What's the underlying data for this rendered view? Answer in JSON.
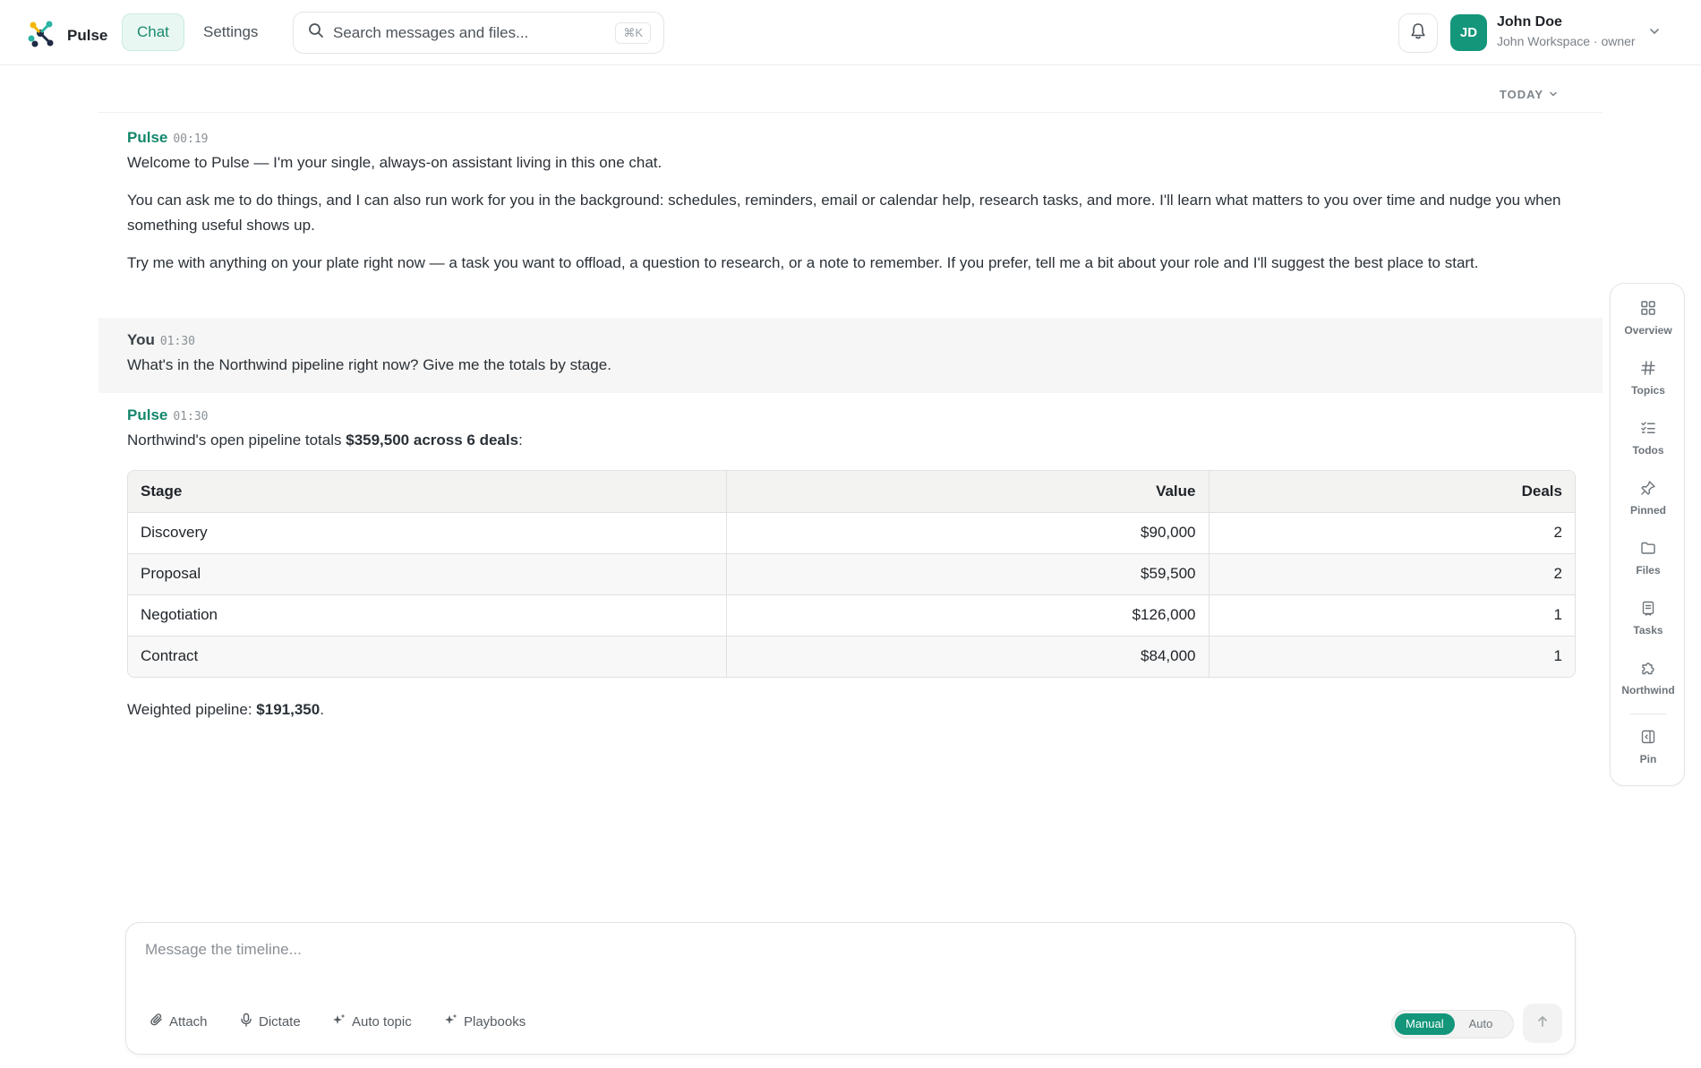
{
  "app": {
    "name": "Pulse"
  },
  "nav": {
    "tabs": [
      {
        "label": "Chat",
        "active": true
      },
      {
        "label": "Settings",
        "active": false
      }
    ]
  },
  "search": {
    "placeholder": "Search messages and files...",
    "shortcut": "⌘K"
  },
  "user": {
    "initials": "JD",
    "name": "John Doe",
    "subtitle": "John Workspace · owner"
  },
  "timeline": {
    "day_label": "TODAY",
    "messages": [
      {
        "author": "Pulse",
        "time": "00:19",
        "paragraphs": [
          "Welcome to Pulse — I'm your single, always-on assistant living in this one chat.",
          "You can ask me to do things, and I can also run work for you in the background: schedules, reminders, email or calendar help, research tasks, and more. I'll learn what matters to you over time and nudge you when something useful shows up.",
          "Try me with anything on your plate right now — a task you want to offload, a question to research, or a note to remember. If you prefer, tell me a bit about your role and I'll suggest the best place to start."
        ]
      },
      {
        "author": "You",
        "time": "01:30",
        "text": "What's in the Northwind pipeline right now? Give me the totals by stage."
      },
      {
        "author": "Pulse",
        "time": "01:30",
        "intro_prefix": "Northwind's open pipeline totals ",
        "intro_bold": "$359,500 across 6 deals",
        "intro_suffix": ":",
        "table": {
          "headers": [
            "Stage",
            "Value",
            "Deals"
          ],
          "rows": [
            [
              "Discovery",
              "$90,000",
              "2"
            ],
            [
              "Proposal",
              "$59,500",
              "2"
            ],
            [
              "Negotiation",
              "$126,000",
              "1"
            ],
            [
              "Contract",
              "$84,000",
              "1"
            ]
          ]
        },
        "weighted_prefix": "Weighted pipeline: ",
        "weighted_bold": "$191,350",
        "weighted_suffix": "."
      }
    ]
  },
  "rail": {
    "items": [
      {
        "label": "Overview",
        "icon": "grid-icon"
      },
      {
        "label": "Topics",
        "icon": "hash-icon"
      },
      {
        "label": "Todos",
        "icon": "checklist-icon"
      },
      {
        "label": "Pinned",
        "icon": "pin-icon"
      },
      {
        "label": "Files",
        "icon": "folder-icon"
      },
      {
        "label": "Tasks",
        "icon": "clipboard-icon"
      },
      {
        "label": "Northwind",
        "icon": "puzzle-icon"
      },
      {
        "label": "Pin",
        "icon": "panel-icon"
      }
    ]
  },
  "composer": {
    "placeholder": "Message the timeline...",
    "tools": [
      {
        "label": "Attach",
        "icon": "paperclip-icon"
      },
      {
        "label": "Dictate",
        "icon": "mic-icon"
      },
      {
        "label": "Auto topic",
        "icon": "sparkle-icon"
      },
      {
        "label": "Playbooks",
        "icon": "sparkle-icon"
      }
    ],
    "modes": [
      {
        "label": "Manual",
        "active": true
      },
      {
        "label": "Auto",
        "active": false
      }
    ]
  },
  "colors": {
    "accent": "#13967a",
    "accent_text": "#13876c",
    "tab_active_bg": "#e9f7f2"
  }
}
